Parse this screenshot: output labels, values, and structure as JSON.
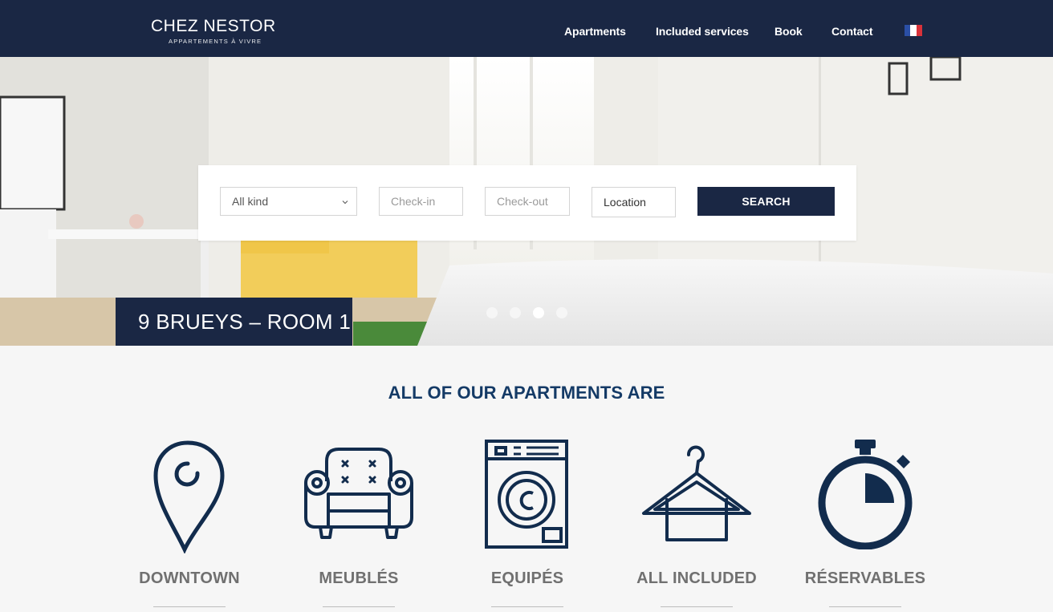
{
  "header": {
    "logo_main": "CHEZ NESTOR",
    "logo_sub": "APPARTEMENTS À VIVRE",
    "nav": [
      "Apartments",
      "Included services",
      "Book",
      "Contact"
    ],
    "language_flag": "french-flag-icon"
  },
  "search": {
    "kind_value": "All kind",
    "checkin_placeholder": "Check-in",
    "checkout_placeholder": "Check-out",
    "location_value": "Location",
    "button_label": "SEARCH"
  },
  "slider": {
    "caption": "9 BRUEYS – ROOM 1",
    "slide_count": 4,
    "active_slide": 3
  },
  "features": {
    "title": "ALL OF OUR APARTMENTS ARE",
    "items": [
      {
        "label": "DOWNTOWN",
        "icon": "map-pin-icon"
      },
      {
        "label": "MEUBLÉS",
        "icon": "armchair-icon"
      },
      {
        "label": "EQUIPÉS",
        "icon": "washing-machine-icon"
      },
      {
        "label": "ALL INCLUDED",
        "icon": "hanger-icon"
      },
      {
        "label": "RÉSERVABLES",
        "icon": "stopwatch-icon"
      }
    ]
  },
  "colors": {
    "navy": "#1a2744",
    "title_blue": "#143a66",
    "label_gray": "#707070",
    "background": "#f6f6f6"
  }
}
